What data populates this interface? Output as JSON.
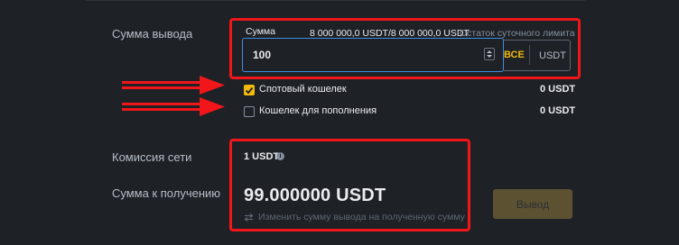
{
  "withdraw_label": "Сумма вывода",
  "amount": {
    "title": "Сумма",
    "limit_value": "8 000 000,0 USDT/8 000 000,0 USDT",
    "limit_label": "Остаток суточного лимита",
    "value": "100",
    "all_label": "ВСЕ",
    "unit": "USDT"
  },
  "wallets": [
    {
      "label": "Спотовый кошелек",
      "balance": "0 USDT",
      "checked": true
    },
    {
      "label": "Кошелек для пополнения",
      "balance": "0 USDT",
      "checked": false
    }
  ],
  "fee": {
    "label": "Комиссия сети",
    "value": "1 USDT"
  },
  "receive": {
    "label": "Сумма к получению",
    "amount": "99.000000 USDT",
    "switch_text": "Изменить сумму вывода на полученную сумму"
  },
  "withdraw_button": "Вывод",
  "colors": {
    "accent": "#f0b90b",
    "annotation_red": "#f0161a",
    "input_focus": "#3d8ee0"
  }
}
